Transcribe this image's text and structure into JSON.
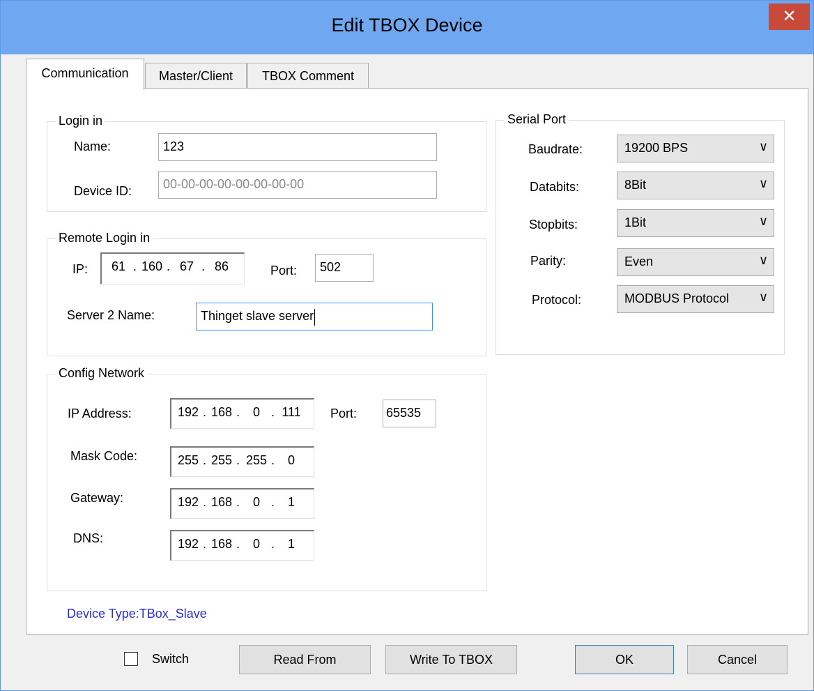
{
  "window": {
    "title": "Edit TBOX Device",
    "close_glyph": "✕"
  },
  "tabs": [
    {
      "label": "Communication",
      "active": true
    },
    {
      "label": "Master/Client",
      "active": false
    },
    {
      "label": "TBOX Comment",
      "active": false
    }
  ],
  "login": {
    "group_label": "Login in",
    "name_label": "Name:",
    "name_value": "123",
    "device_id_label": "Device ID:",
    "device_id_placeholder": "00-00-00-00-00-00-00-00"
  },
  "remote": {
    "group_label": "Remote Login in",
    "ip_label": "IP:",
    "ip": [
      "61",
      "160",
      "67",
      "86"
    ],
    "port_label": "Port:",
    "port_value": "502",
    "server_label": "Server 2 Name:",
    "server_value": "Thinget slave server"
  },
  "network": {
    "group_label": "Config Network",
    "ip_label": "IP Address:",
    "ip": [
      "192",
      "168",
      "0",
      "111"
    ],
    "port_label": "Port:",
    "port_value": "65535",
    "mask_label": "Mask Code:",
    "mask": [
      "255",
      "255",
      "255",
      "0"
    ],
    "gateway_label": "Gateway:",
    "gateway": [
      "192",
      "168",
      "0",
      "1"
    ],
    "dns_label": "DNS:",
    "dns": [
      "192",
      "168",
      "0",
      "1"
    ]
  },
  "serial": {
    "group_label": "Serial Port",
    "baudrate_label": "Baudrate:",
    "baudrate_value": "19200 BPS",
    "databits_label": "Databits:",
    "databits_value": "8Bit",
    "stopbits_label": "Stopbits:",
    "stopbits_value": "1Bit",
    "parity_label": "Parity:",
    "parity_value": "Even",
    "protocol_label": "Protocol:",
    "protocol_value": "MODBUS Protocol",
    "chevron_glyph": "∨"
  },
  "device_type": {
    "text": "Device Type:TBox_Slave",
    "color": "#2b2bd6"
  },
  "footer": {
    "switch_label": "Switch",
    "read_from_label": "Read From",
    "write_label": "Write To TBOX",
    "ok_label": "OK",
    "cancel_label": "Cancel"
  },
  "colors": {
    "titlebar": "#6fa8f0",
    "close": "#c74a3b",
    "focus": "#3399ff"
  }
}
